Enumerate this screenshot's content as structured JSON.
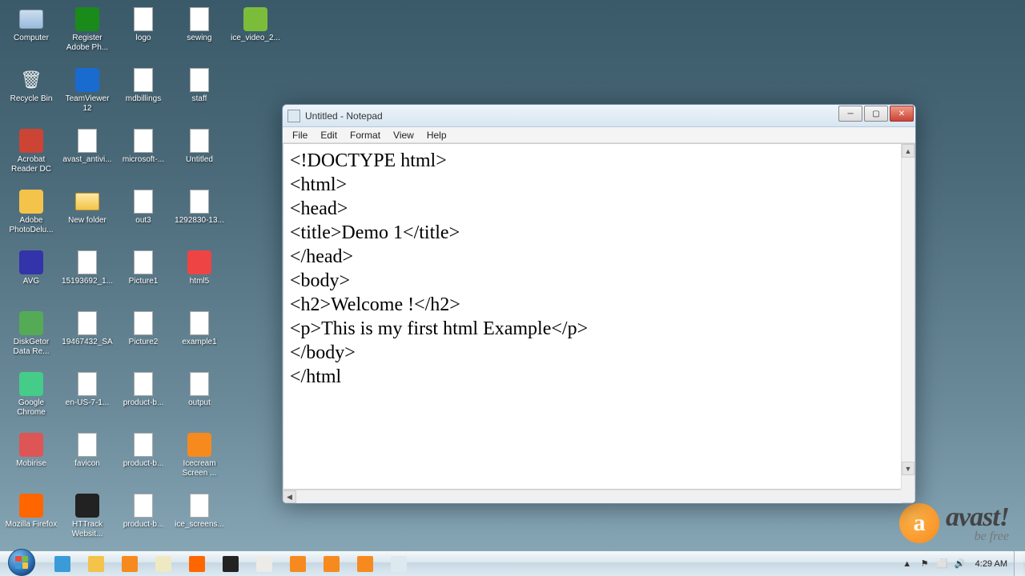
{
  "desktop": {
    "icons": [
      [
        {
          "label": "Computer",
          "icon": "computer"
        },
        {
          "label": "Register Adobe Ph...",
          "icon": "app",
          "bg": "#1a8a1a"
        },
        {
          "label": "logo",
          "icon": "file"
        },
        {
          "label": "sewing",
          "icon": "file"
        },
        {
          "label": "ice_video_2...",
          "icon": "app",
          "bg": "#7bbd3a"
        }
      ],
      [
        {
          "label": "Recycle Bin",
          "icon": "bin"
        },
        {
          "label": "TeamViewer 12",
          "icon": "app",
          "bg": "#1a6bd0"
        },
        {
          "label": "mdbillings",
          "icon": "file"
        },
        {
          "label": "staff",
          "icon": "file"
        }
      ],
      [
        {
          "label": "Acrobat Reader DC",
          "icon": "app",
          "bg": "#c43"
        },
        {
          "label": "avast_antivi...",
          "icon": "file"
        },
        {
          "label": "microsoft-...",
          "icon": "file"
        },
        {
          "label": "Untitled",
          "icon": "file"
        }
      ],
      [
        {
          "label": "Adobe PhotoDelu...",
          "icon": "app",
          "bg": "#f3c34a"
        },
        {
          "label": "New folder",
          "icon": "folder"
        },
        {
          "label": "out3",
          "icon": "file"
        },
        {
          "label": "1292830-13...",
          "icon": "file"
        }
      ],
      [
        {
          "label": "AVG",
          "icon": "app",
          "bg": "#33a"
        },
        {
          "label": "15193692_1...",
          "icon": "file"
        },
        {
          "label": "Picture1",
          "icon": "file"
        },
        {
          "label": "html5",
          "icon": "app",
          "bg": "#e44"
        }
      ],
      [
        {
          "label": "DiskGetor Data Re...",
          "icon": "app",
          "bg": "#5a5"
        },
        {
          "label": "19467432_SA",
          "icon": "file"
        },
        {
          "label": "Picture2",
          "icon": "file"
        },
        {
          "label": "example1",
          "icon": "file"
        }
      ],
      [
        {
          "label": "Google Chrome",
          "icon": "app",
          "bg": "#4c8"
        },
        {
          "label": "en-US-7-1...",
          "icon": "file"
        },
        {
          "label": "product-b...",
          "icon": "file"
        },
        {
          "label": "output",
          "icon": "file"
        }
      ],
      [
        {
          "label": "Mobirise",
          "icon": "app",
          "bg": "#d55"
        },
        {
          "label": "favicon",
          "icon": "file"
        },
        {
          "label": "product-b...",
          "icon": "file"
        },
        {
          "label": "Icecream Screen ...",
          "icon": "app",
          "bg": "#f78a1e"
        }
      ],
      [
        {
          "label": "Mozilla Firefox",
          "icon": "app",
          "bg": "#f60"
        },
        {
          "label": "HTTrack Websit...",
          "icon": "app",
          "bg": "#222"
        },
        {
          "label": "product-b...",
          "icon": "file"
        },
        {
          "label": "ice_screens...",
          "icon": "file"
        }
      ]
    ]
  },
  "avast": {
    "brand": "avast!",
    "tagline": "be free"
  },
  "taskbar": {
    "items": [
      {
        "name": "ie",
        "bg": "#3a9bd8"
      },
      {
        "name": "explorer",
        "bg": "#f3c34a"
      },
      {
        "name": "wmp",
        "bg": "#f78a1e"
      },
      {
        "name": "notes",
        "bg": "#efe9c3"
      },
      {
        "name": "firefox",
        "bg": "#f60"
      },
      {
        "name": "cmd",
        "bg": "#222"
      },
      {
        "name": "chrome",
        "bg": "#ecebe8"
      },
      {
        "name": "xampp",
        "bg": "#f78a1e"
      },
      {
        "name": "rec",
        "bg": "#f78a1e"
      },
      {
        "name": "app",
        "bg": "#f78a1e"
      },
      {
        "name": "notepad",
        "bg": "#dceaf0"
      }
    ],
    "clock": "4:29 AM"
  },
  "notepad": {
    "title": "Untitled - Notepad",
    "menus": [
      "File",
      "Edit",
      "Format",
      "View",
      "Help"
    ],
    "content": "<!DOCTYPE html>\n<html>\n<head>\n<title>Demo 1</title>\n</head>\n<body>\n<h2>Welcome !</h2>\n<p>This is my first html Example</p>\n</body>\n</html"
  }
}
